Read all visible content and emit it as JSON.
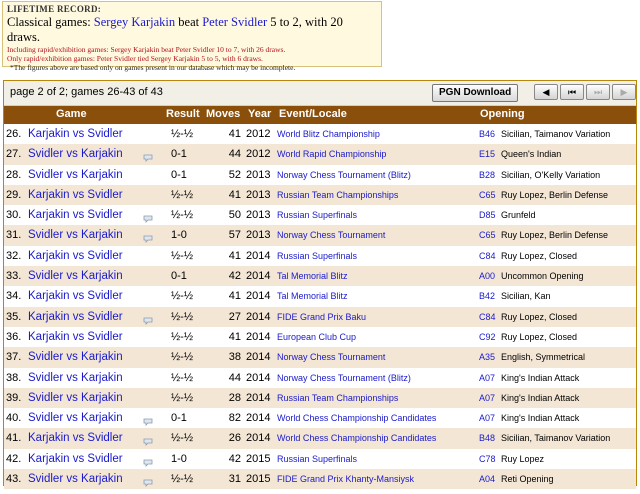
{
  "record": {
    "heading": "LIFETIME RECORD:",
    "classical_prefix": "Classical games: ",
    "classical_p1": "Sergey Karjakin",
    "classical_mid": " beat ",
    "classical_p2": "Peter Svidler",
    "classical_suffix": " 5 to 2, with 20 draws.",
    "rapid_line": "Including rapid/exhibition games: Sergey Karjakin beat Peter Svidler 10 to 7, with 26 draws.",
    "only_line": "Only rapid/exhibition games: Peter Svidler tied Sergey Karjakin 5 to 5, with 6 draws.",
    "note": "*The figures above are based only on games present in our database which may be incomplete."
  },
  "toolbar": {
    "page_info": "page 2 of 2; games 26-43 of 43",
    "pgn_label": "PGN Download",
    "nav": [
      "◀",
      "⏮",
      "⏭",
      "▶"
    ]
  },
  "columns": {
    "game": "Game",
    "result": "Result",
    "moves": "Moves",
    "year": "Year",
    "event": "Event/Locale",
    "opening": "Opening"
  },
  "games": [
    {
      "num": "26.",
      "game": "Karjakin vs Svidler",
      "kib": false,
      "result": "½-½",
      "moves": "41",
      "year": "2012",
      "event": "World Blitz Championship",
      "eco": "B46",
      "opening": "Sicilian, Taimanov Variation"
    },
    {
      "num": "27.",
      "game": "Svidler vs Karjakin",
      "kib": true,
      "result": "0-1",
      "moves": "44",
      "year": "2012",
      "event": "World Rapid Championship",
      "eco": "E15",
      "opening": "Queen's Indian"
    },
    {
      "num": "28.",
      "game": "Svidler vs Karjakin",
      "kib": false,
      "result": "0-1",
      "moves": "52",
      "year": "2013",
      "event": "Norway Chess Tournament (Blitz)",
      "eco": "B28",
      "opening": "Sicilian, O'Kelly Variation"
    },
    {
      "num": "29.",
      "game": "Karjakin vs Svidler",
      "kib": false,
      "result": "½-½",
      "moves": "41",
      "year": "2013",
      "event": "Russian Team Championships",
      "eco": "C65",
      "opening": "Ruy Lopez, Berlin Defense"
    },
    {
      "num": "30.",
      "game": "Karjakin vs Svidler",
      "kib": true,
      "result": "½-½",
      "moves": "50",
      "year": "2013",
      "event": "Russian Superfinals",
      "eco": "D85",
      "opening": "Grunfeld"
    },
    {
      "num": "31.",
      "game": "Svidler vs Karjakin",
      "kib": true,
      "result": "1-0",
      "moves": "57",
      "year": "2013",
      "event": "Norway Chess Tournament",
      "eco": "C65",
      "opening": "Ruy Lopez, Berlin Defense"
    },
    {
      "num": "32.",
      "game": "Karjakin vs Svidler",
      "kib": false,
      "result": "½-½",
      "moves": "41",
      "year": "2014",
      "event": "Russian Superfinals",
      "eco": "C84",
      "opening": "Ruy Lopez, Closed"
    },
    {
      "num": "33.",
      "game": "Svidler vs Karjakin",
      "kib": false,
      "result": "0-1",
      "moves": "42",
      "year": "2014",
      "event": "Tal Memorial Blitz",
      "eco": "A00",
      "opening": "Uncommon Opening"
    },
    {
      "num": "34.",
      "game": "Karjakin vs Svidler",
      "kib": false,
      "result": "½-½",
      "moves": "41",
      "year": "2014",
      "event": "Tal Memorial Blitz",
      "eco": "B42",
      "opening": "Sicilian, Kan"
    },
    {
      "num": "35.",
      "game": "Karjakin vs Svidler",
      "kib": true,
      "result": "½-½",
      "moves": "27",
      "year": "2014",
      "event": "FIDE Grand Prix Baku",
      "eco": "C84",
      "opening": "Ruy Lopez, Closed"
    },
    {
      "num": "36.",
      "game": "Karjakin vs Svidler",
      "kib": false,
      "result": "½-½",
      "moves": "41",
      "year": "2014",
      "event": "European Club Cup",
      "eco": "C92",
      "opening": "Ruy Lopez, Closed"
    },
    {
      "num": "37.",
      "game": "Svidler vs Karjakin",
      "kib": false,
      "result": "½-½",
      "moves": "38",
      "year": "2014",
      "event": "Norway Chess Tournament",
      "eco": "A35",
      "opening": "English, Symmetrical"
    },
    {
      "num": "38.",
      "game": "Svidler vs Karjakin",
      "kib": false,
      "result": "½-½",
      "moves": "44",
      "year": "2014",
      "event": "Norway Chess Tournament (Blitz)",
      "eco": "A07",
      "opening": "King's Indian Attack"
    },
    {
      "num": "39.",
      "game": "Svidler vs Karjakin",
      "kib": false,
      "result": "½-½",
      "moves": "28",
      "year": "2014",
      "event": "Russian Team Championships",
      "eco": "A07",
      "opening": "King's Indian Attack"
    },
    {
      "num": "40.",
      "game": "Svidler vs Karjakin",
      "kib": true,
      "result": "0-1",
      "moves": "82",
      "year": "2014",
      "event": "World Chess Championship Candidates",
      "eco": "A07",
      "opening": "King's Indian Attack"
    },
    {
      "num": "41.",
      "game": "Karjakin vs Svidler",
      "kib": true,
      "result": "½-½",
      "moves": "26",
      "year": "2014",
      "event": "World Chess Championship Candidates",
      "eco": "B48",
      "opening": "Sicilian, Taimanov Variation"
    },
    {
      "num": "42.",
      "game": "Karjakin vs Svidler",
      "kib": true,
      "result": "1-0",
      "moves": "42",
      "year": "2015",
      "event": "Russian Superfinals",
      "eco": "C78",
      "opening": "Ruy Lopez"
    },
    {
      "num": "43.",
      "game": "Svidler vs Karjakin",
      "kib": true,
      "result": "½-½",
      "moves": "31",
      "year": "2015",
      "event": "FIDE Grand Prix Khanty-Mansiysk",
      "eco": "A04",
      "opening": "Reti Opening"
    }
  ]
}
